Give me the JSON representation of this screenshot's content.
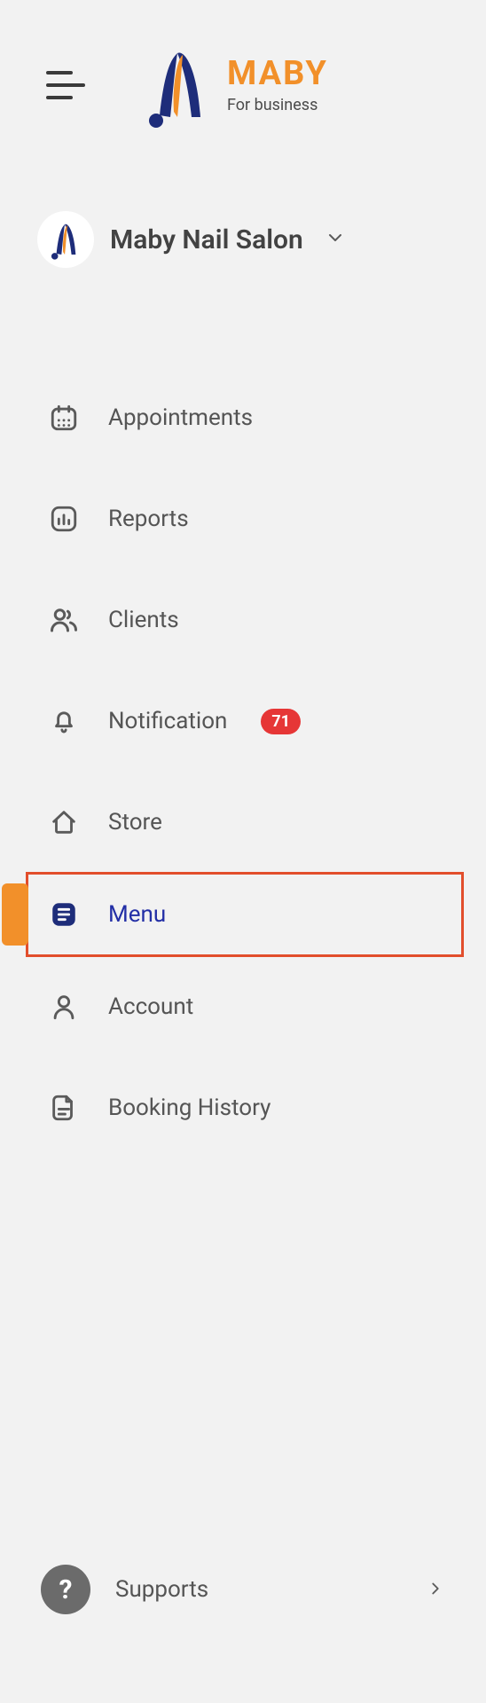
{
  "header": {
    "brand": "MABY",
    "subtitle": "For business"
  },
  "salon": {
    "name": "Maby Nail Salon"
  },
  "nav": {
    "appointments": "Appointments",
    "reports": "Reports",
    "clients": "Clients",
    "notification": "Notification",
    "notification_badge": "71",
    "store": "Store",
    "menu": "Menu",
    "account": "Account",
    "booking_history": "Booking History"
  },
  "footer": {
    "supports": "Supports",
    "help_glyph": "?"
  }
}
